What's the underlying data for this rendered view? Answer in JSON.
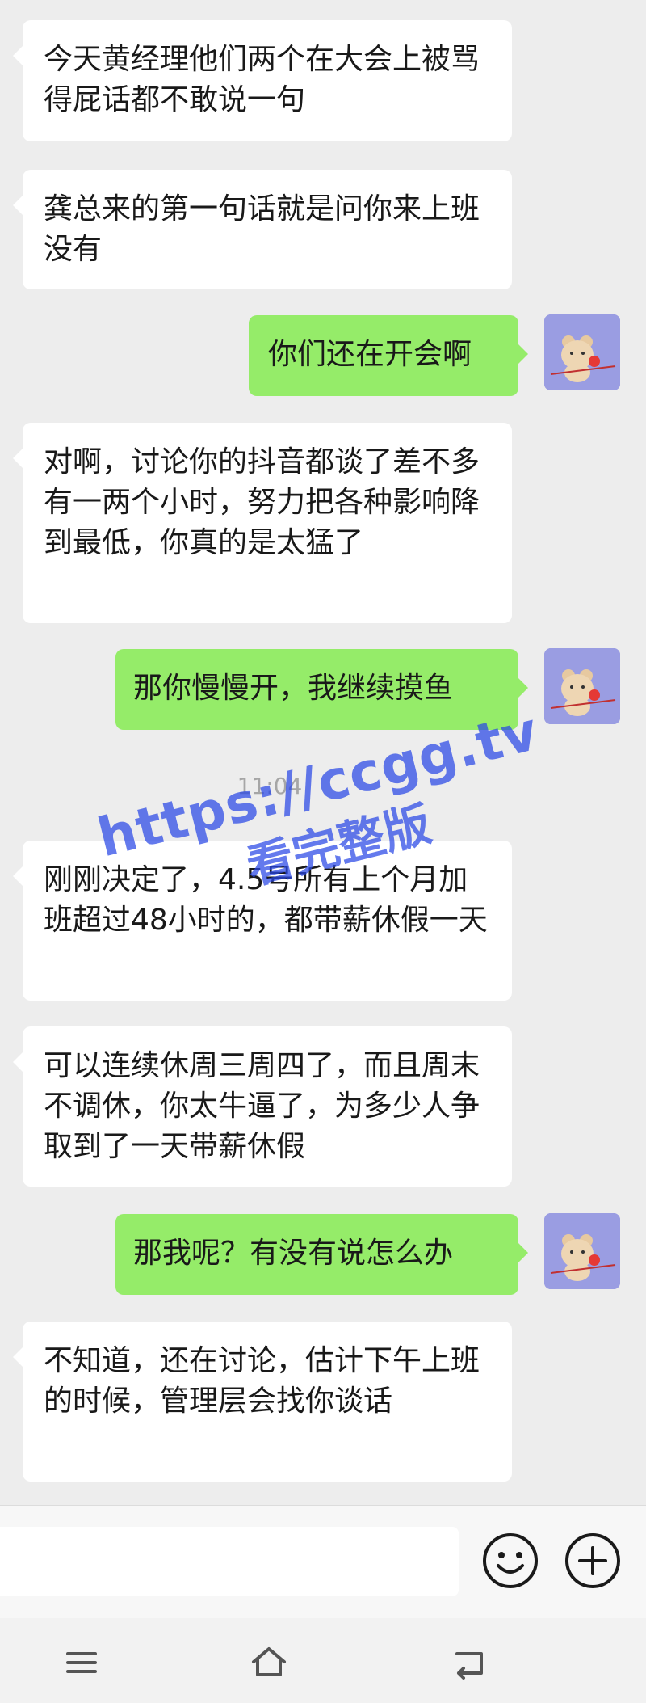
{
  "messages": [
    {
      "side": "left",
      "text": "今天黄经理他们两个在大会上被骂得屁话都不敢说一句"
    },
    {
      "side": "left",
      "text": "龚总来的第一句话就是问你来上班没有"
    },
    {
      "side": "right",
      "text": "你们还在开会啊"
    },
    {
      "side": "left",
      "text": "对啊，讨论你的抖音都谈了差不多有一两个小时，努力把各种影响降到最低，你真的是太猛了"
    },
    {
      "side": "right",
      "text": "那你慢慢开，我继续摸鱼"
    },
    {
      "side": "left",
      "text": "刚刚决定了，4.5号所有上个月加班超过48小时的，都带薪休假一天"
    },
    {
      "side": "left",
      "text": "可以连续休周三周四了，而且周末不调休，你太牛逼了，为多少人争取到了一天带薪休假"
    },
    {
      "side": "right",
      "text": "那我呢？有没有说怎么办"
    },
    {
      "side": "left",
      "text": "不知道，还在讨论，估计下午上班的时候，管理层会找你谈话"
    }
  ],
  "timestamp": "11:04",
  "watermark": {
    "line1": "https://ccgg.tv",
    "line2": "看完整版"
  },
  "input": {
    "value": "",
    "placeholder": ""
  },
  "icons": {
    "emoji": "smiley-icon",
    "add": "plus-circle-icon",
    "nav_menu": "menu-icon",
    "nav_home": "home-icon",
    "nav_back": "back-icon"
  },
  "colors": {
    "background": "#ededed",
    "left_bubble": "#ffffff",
    "right_bubble": "#95ec69",
    "avatar_bg": "#9a9de2",
    "watermark": "#2846e6"
  }
}
